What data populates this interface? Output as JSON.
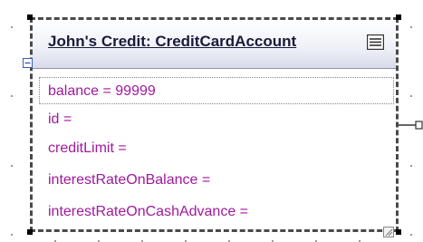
{
  "object": {
    "title": "John's Credit: CreditCardAccount",
    "slots": [
      {
        "label": "balance =  99999"
      },
      {
        "label": "id ="
      },
      {
        "label": "creditLimit ="
      },
      {
        "label": "interestRateOnBalance ="
      },
      {
        "label": "interestRateOnCashAdvance ="
      }
    ]
  },
  "icons": {
    "menu": "menu-lines-icon",
    "collapse": "collapse-minus-icon",
    "resize": "resize-grip-icon"
  },
  "colors": {
    "slot_text": "#a0199d",
    "title_text": "#1b1b3a",
    "border": "#4a4a4a",
    "header_gradient_end": "#d9dbeb"
  }
}
